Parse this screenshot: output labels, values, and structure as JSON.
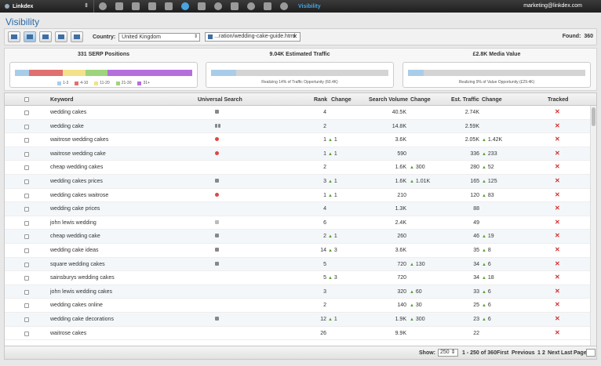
{
  "topbar": {
    "app_name": "Linkdex",
    "section": "Visibility",
    "user_email": "marketing@linkdex.com"
  },
  "page_title": "Visibility",
  "toolbar": {
    "country_label": "Country:",
    "country_value": "United Kingdom",
    "filter_value": "...ration/wedding-cake-guide.html",
    "found_label": "Found:",
    "found_count": "360"
  },
  "stats": {
    "serp": {
      "title": "331 SERP Positions",
      "segments": [
        {
          "label": "1-3",
          "color": "#a9cde9",
          "share": 0.08
        },
        {
          "label": "4-10",
          "color": "#e07070",
          "share": 0.19
        },
        {
          "label": "11-20",
          "color": "#f3e28b",
          "share": 0.13
        },
        {
          "label": "21-30",
          "color": "#9fd47f",
          "share": 0.12
        },
        {
          "label": "31+",
          "color": "#b46fdc",
          "share": 0.48
        }
      ]
    },
    "traffic": {
      "title": "9.04K Estimated Traffic",
      "caption": "Realizing 14% of Traffic Opportunity (60.4K)",
      "fill": 0.14,
      "fill_color": "#a9cde9"
    },
    "media": {
      "title": "£2.8K Media Value",
      "caption": "Realizing 9% of Value Opportunity (£29.4K)",
      "fill": 0.09,
      "fill_color": "#a9cde9"
    }
  },
  "table": {
    "headers": {
      "keyword": "Keyword",
      "universal": "Universal Search",
      "rank": "Rank",
      "rank_change": "Change",
      "volume": "Search Volume",
      "volume_change": "Change",
      "traffic": "Est. Traffic",
      "traffic_change": "Change",
      "tracked": "Tracked"
    },
    "rows": [
      {
        "keyword": "wedding cakes",
        "us": "g",
        "rank": "4",
        "rchg": "",
        "volume": "40.5K",
        "vchg": "",
        "traffic": "2.74K",
        "tchg": "",
        "tracked": "✕"
      },
      {
        "keyword": "wedding cake",
        "us": "gg",
        "rank": "2",
        "rchg": "",
        "volume": "14.8K",
        "vchg": "",
        "traffic": "2.59K",
        "tchg": "",
        "tracked": "✕"
      },
      {
        "keyword": "waitrose wedding cakes",
        "us": "r",
        "rank": "1",
        "rchg": "1",
        "volume": "3.6K",
        "vchg": "",
        "traffic": "2.05K",
        "tchg": "1.42K",
        "tracked": "✕"
      },
      {
        "keyword": "waitrose wedding cake",
        "us": "r",
        "rank": "1",
        "rchg": "1",
        "volume": "590",
        "vchg": "",
        "traffic": "336",
        "tchg": "233",
        "tracked": "✕"
      },
      {
        "keyword": "cheap wedding cakes",
        "us": "",
        "rank": "2",
        "rchg": "",
        "volume": "1.6K",
        "vchg": "300",
        "traffic": "280",
        "tchg": "52",
        "tracked": "✕"
      },
      {
        "keyword": "wedding cakes prices",
        "us": "g",
        "rank": "3",
        "rchg": "1",
        "volume": "1.6K",
        "vchg": "1.01K",
        "traffic": "165",
        "tchg": "125",
        "tracked": "✕"
      },
      {
        "keyword": "wedding cakes waitrose",
        "us": "r",
        "rank": "1",
        "rchg": "1",
        "volume": "210",
        "vchg": "",
        "traffic": "120",
        "tchg": "83",
        "tracked": "✕"
      },
      {
        "keyword": "wedding cake prices",
        "us": "",
        "rank": "4",
        "rchg": "",
        "volume": "1.3K",
        "vchg": "",
        "traffic": "88",
        "tchg": "",
        "tracked": "✕"
      },
      {
        "keyword": "john lewis wedding",
        "us": "s",
        "rank": "6",
        "rchg": "",
        "volume": "2.4K",
        "vchg": "",
        "traffic": "49",
        "tchg": "",
        "tracked": "✕"
      },
      {
        "keyword": "cheap wedding cake",
        "us": "g",
        "rank": "2",
        "rchg": "1",
        "volume": "260",
        "vchg": "",
        "traffic": "46",
        "tchg": "19",
        "tracked": "✕"
      },
      {
        "keyword": "wedding cake ideas",
        "us": "g",
        "rank": "14",
        "rchg": "3",
        "volume": "3.6K",
        "vchg": "",
        "traffic": "35",
        "tchg": "8",
        "tracked": "✕"
      },
      {
        "keyword": "square wedding cakes",
        "us": "g",
        "rank": "5",
        "rchg": "",
        "volume": "720",
        "vchg": "130",
        "traffic": "34",
        "tchg": "6",
        "tracked": "✕"
      },
      {
        "keyword": "sainsburys wedding cakes",
        "us": "",
        "rank": "5",
        "rchg": "3",
        "volume": "720",
        "vchg": "",
        "traffic": "34",
        "tchg": "18",
        "tracked": "✕"
      },
      {
        "keyword": "john lewis wedding cakes",
        "us": "",
        "rank": "3",
        "rchg": "",
        "volume": "320",
        "vchg": "60",
        "traffic": "33",
        "tchg": "6",
        "tracked": "✕"
      },
      {
        "keyword": "wedding cakes online",
        "us": "",
        "rank": "2",
        "rchg": "",
        "volume": "140",
        "vchg": "30",
        "traffic": "25",
        "tchg": "6",
        "tracked": "✕"
      },
      {
        "keyword": "wedding cake decorations",
        "us": "g",
        "rank": "12",
        "rchg": "1",
        "volume": "1.9K",
        "vchg": "300",
        "traffic": "23",
        "tchg": "6",
        "tracked": "✕"
      },
      {
        "keyword": "waitrose cakes",
        "us": "",
        "rank": "26",
        "rchg": "",
        "volume": "9.9K",
        "vchg": "",
        "traffic": "22",
        "tchg": "",
        "tracked": "✕"
      }
    ]
  },
  "footer": {
    "show_label": "Show:",
    "show_value": "250",
    "range": "1 - 250 of 360",
    "first": "First",
    "previous": "Previous",
    "page1": "1",
    "page2": "2",
    "next": "Next",
    "last": "Last",
    "page_label": "Page"
  }
}
